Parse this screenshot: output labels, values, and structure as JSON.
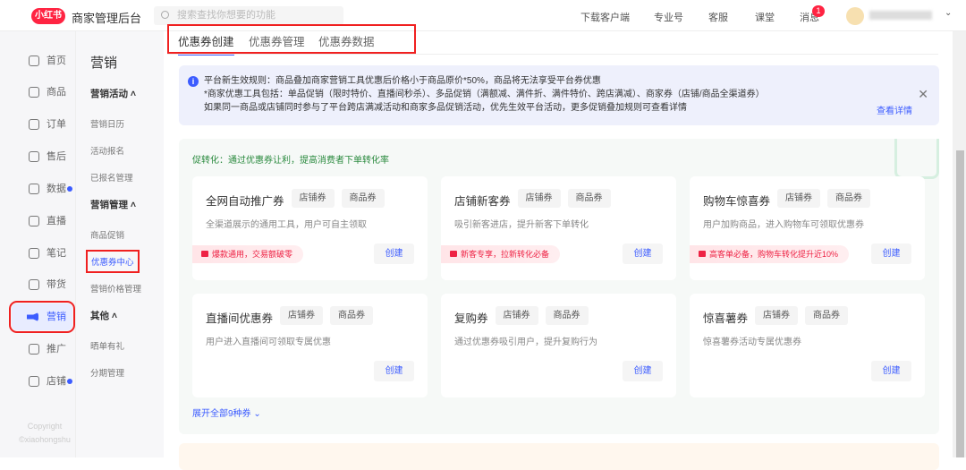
{
  "header": {
    "logo": "小红书",
    "title": "商家管理后台",
    "search_placeholder": "搜索查找你想要的功能",
    "links": [
      "下载客户端",
      "专业号",
      "客服",
      "课堂",
      "消息"
    ],
    "message_badge": "1"
  },
  "nav1": {
    "items": [
      {
        "label": "首页",
        "icon": "home-icon"
      },
      {
        "label": "商品",
        "icon": "goods-icon"
      },
      {
        "label": "订单",
        "icon": "order-icon"
      },
      {
        "label": "售后",
        "icon": "after-sale-icon"
      },
      {
        "label": "数据",
        "icon": "data-icon",
        "dot": true
      },
      {
        "label": "直播",
        "icon": "live-icon"
      },
      {
        "label": "笔记",
        "icon": "notes-icon"
      },
      {
        "label": "带货",
        "icon": "bag-icon"
      },
      {
        "label": "营销",
        "icon": "megaphone-icon",
        "active": true
      },
      {
        "label": "推广",
        "icon": "promote-icon"
      },
      {
        "label": "店铺",
        "icon": "shop-icon",
        "dot": true
      }
    ],
    "copyright": [
      "Copyright",
      "©xiaohongshu"
    ]
  },
  "nav2": {
    "title": "营销",
    "groups": [
      {
        "label": "营销活动",
        "items": [
          "营销日历",
          "活动报名",
          "已报名管理"
        ]
      },
      {
        "label": "营销管理",
        "items": [
          "商品促销",
          "优惠券中心",
          "营销价格管理"
        ]
      },
      {
        "label": "其他",
        "items": [
          "晒单有礼",
          "分期管理"
        ]
      }
    ]
  },
  "tabs": [
    "优惠券创建",
    "优惠券管理",
    "优惠券数据"
  ],
  "notice": {
    "lines": [
      "平台新生效规则：商品叠加商家营销工具优惠后价格小于商品原价*50%，商品将无法享受平台券优惠",
      "*商家优惠工具包括：单品促销（限时特价、直播间秒杀）、多品促销（满额减、满件折、满件特价、跨店满减）、商家券（店铺/商品全渠道券）",
      "如果同一商品或店铺同时参与了平台跨店满减活动和商家多品促销活动，优先生效平台活动，更多促销叠加规则可查看详情"
    ],
    "more": "查看详情"
  },
  "promo": {
    "head": "促转化：通过优惠券让利，提高消费者下单转化率",
    "tags": [
      "店铺券",
      "商品券"
    ],
    "create": "创建",
    "expand": "展开全部9种券",
    "cards": [
      {
        "name": "全网自动推广券",
        "desc": "全渠道展示的通用工具，用户可自主领取",
        "highlight": "爆款通用，交易额破零"
      },
      {
        "name": "店铺新客券",
        "desc": "吸引新客进店，提升新客下单转化",
        "highlight": "新客专享，拉新转化必备"
      },
      {
        "name": "购物车惊喜券",
        "desc": "用户加购商品，进入购物车可领取优惠券",
        "highlight": "高客单必备，购物车转化提升近10%"
      },
      {
        "name": "直播间优惠券",
        "desc": "用户进入直播间可领取专属优惠",
        "highlight": ""
      },
      {
        "name": "复购券",
        "desc": "通过优惠券吸引用户，提升复购行为",
        "highlight": ""
      },
      {
        "name": "惊喜薯券",
        "desc": "惊喜薯券活动专属优惠券",
        "highlight": ""
      }
    ]
  }
}
